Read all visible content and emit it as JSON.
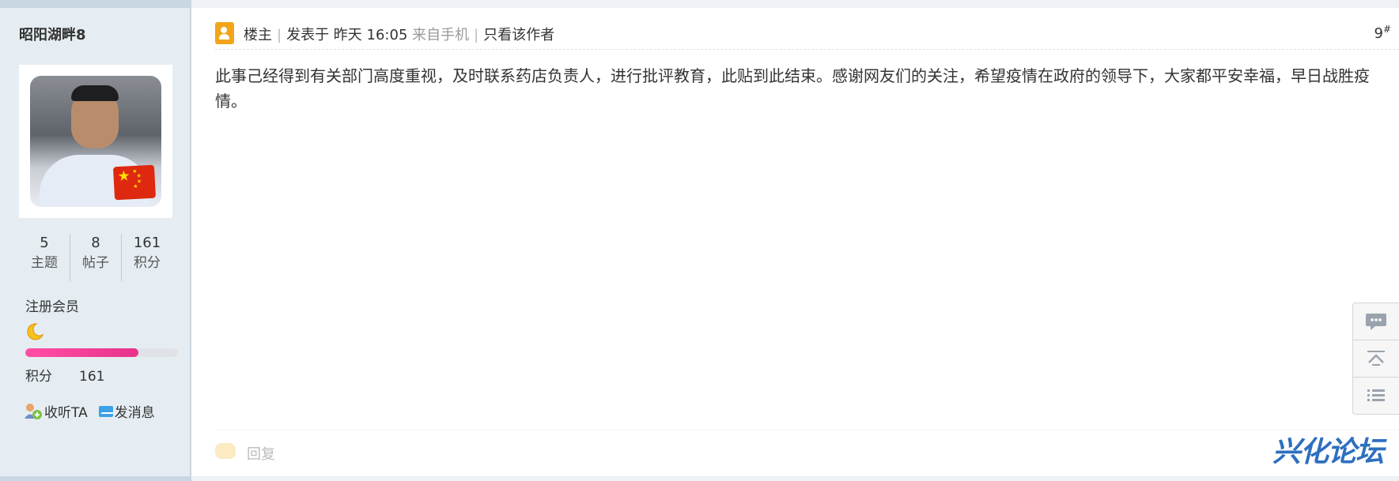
{
  "user": {
    "name": "昭阳湖畔8",
    "stats": [
      {
        "value": "5",
        "label": "主题"
      },
      {
        "value": "8",
        "label": "帖子"
      },
      {
        "value": "161",
        "label": "积分"
      }
    ],
    "group": "注册会员",
    "level_progress": 0.74,
    "credits_label": "积分",
    "credits_value": "161",
    "follow_label": "收听TA",
    "message_label": "发消息"
  },
  "post": {
    "op_label": "楼主",
    "posted_at": "发表于 昨天 16:05",
    "source": "来自手机",
    "only_author": "只看该作者",
    "floor": "9",
    "floor_mark": "#",
    "content": "此事己经得到有关部门高度重视，及时联系药店负责人，进行批评教育，此贴到此结束。感谢网友们的关注，希望疫情在政府的领导下，大家都平安幸福，早日战胜疫情。",
    "reply_label": "回复"
  },
  "logo_text": "兴化论坛",
  "colors": {
    "sidebar_bg": "#e5edf2",
    "level_bar": "#e8338a",
    "op_badge": "#f2a51a",
    "logo": "#2e6fc0"
  },
  "icons": [
    "user-badge-icon",
    "moon-icon",
    "follow-icon",
    "mail-icon",
    "chat-icon",
    "back-to-top-icon",
    "list-icon",
    "reply-icon"
  ]
}
